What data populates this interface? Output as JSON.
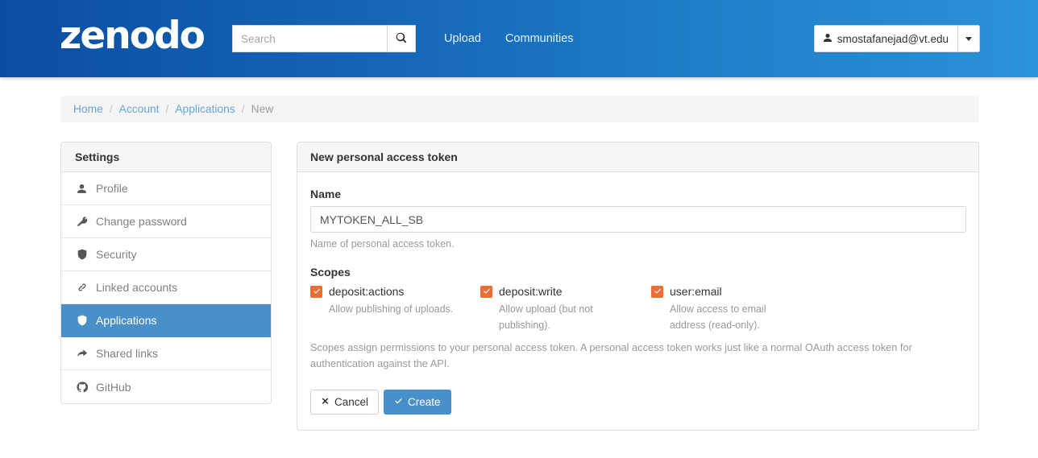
{
  "header": {
    "logo_text": "zenodo",
    "search": {
      "placeholder": "Search",
      "value": "",
      "icon": "search-icon"
    },
    "nav": [
      {
        "label": "Upload"
      },
      {
        "label": "Communities"
      }
    ],
    "user": {
      "email": "smostafanejad@vt.edu",
      "icon": "user-icon",
      "caret_icon": "caret-down-icon"
    }
  },
  "breadcrumb": {
    "items": [
      {
        "label": "Home",
        "current": false
      },
      {
        "label": "Account",
        "current": false
      },
      {
        "label": "Applications",
        "current": false
      },
      {
        "label": "New",
        "current": true
      }
    ],
    "separator": "/"
  },
  "sidebar": {
    "title": "Settings",
    "items": [
      {
        "label": "Profile",
        "icon": "user-icon",
        "active": false
      },
      {
        "label": "Change password",
        "icon": "key-icon",
        "active": false
      },
      {
        "label": "Security",
        "icon": "shield-icon",
        "active": false
      },
      {
        "label": "Linked accounts",
        "icon": "link-icon",
        "active": false
      },
      {
        "label": "Applications",
        "icon": "shield-icon",
        "active": true
      },
      {
        "label": "Shared links",
        "icon": "share-icon",
        "active": false
      },
      {
        "label": "GitHub",
        "icon": "github-icon",
        "active": false
      }
    ]
  },
  "panel": {
    "title": "New personal access token",
    "name_field": {
      "label": "Name",
      "value": "MYTOKEN_ALL_SB",
      "placeholder": "",
      "help": "Name of personal access token."
    },
    "scopes": {
      "label": "Scopes",
      "items": [
        {
          "name": "deposit:actions",
          "description": "Allow publishing of uploads.",
          "checked": true
        },
        {
          "name": "deposit:write",
          "description": "Allow upload (but not publishing).",
          "checked": true
        },
        {
          "name": "user:email",
          "description": "Allow access to email address (read-only).",
          "checked": true
        }
      ],
      "note": "Scopes assign permissions to your personal access token. A personal access token works just like a normal OAuth access token for authentication against the API."
    },
    "buttons": {
      "cancel": "Cancel",
      "create": "Create"
    }
  },
  "colors": {
    "header_gradient_start": "#0b4da2",
    "header_gradient_end": "#2a92da",
    "accent_blue": "#4a90c8",
    "checkbox_orange": "#ef6c35",
    "link_blue": "#6aa3d5",
    "muted_text": "#9a9a9a"
  }
}
